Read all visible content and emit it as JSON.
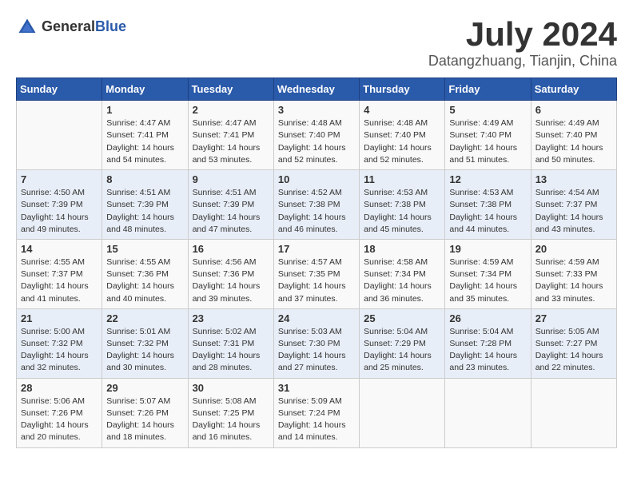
{
  "logo": {
    "general": "General",
    "blue": "Blue"
  },
  "title": "July 2024",
  "location": "Datangzhuang, Tianjin, China",
  "weekdays": [
    "Sunday",
    "Monday",
    "Tuesday",
    "Wednesday",
    "Thursday",
    "Friday",
    "Saturday"
  ],
  "weeks": [
    [
      {
        "day": "",
        "sunrise": "",
        "sunset": "",
        "daylight": ""
      },
      {
        "day": "1",
        "sunrise": "Sunrise: 4:47 AM",
        "sunset": "Sunset: 7:41 PM",
        "daylight": "Daylight: 14 hours and 54 minutes."
      },
      {
        "day": "2",
        "sunrise": "Sunrise: 4:47 AM",
        "sunset": "Sunset: 7:41 PM",
        "daylight": "Daylight: 14 hours and 53 minutes."
      },
      {
        "day": "3",
        "sunrise": "Sunrise: 4:48 AM",
        "sunset": "Sunset: 7:40 PM",
        "daylight": "Daylight: 14 hours and 52 minutes."
      },
      {
        "day": "4",
        "sunrise": "Sunrise: 4:48 AM",
        "sunset": "Sunset: 7:40 PM",
        "daylight": "Daylight: 14 hours and 52 minutes."
      },
      {
        "day": "5",
        "sunrise": "Sunrise: 4:49 AM",
        "sunset": "Sunset: 7:40 PM",
        "daylight": "Daylight: 14 hours and 51 minutes."
      },
      {
        "day": "6",
        "sunrise": "Sunrise: 4:49 AM",
        "sunset": "Sunset: 7:40 PM",
        "daylight": "Daylight: 14 hours and 50 minutes."
      }
    ],
    [
      {
        "day": "7",
        "sunrise": "Sunrise: 4:50 AM",
        "sunset": "Sunset: 7:39 PM",
        "daylight": "Daylight: 14 hours and 49 minutes."
      },
      {
        "day": "8",
        "sunrise": "Sunrise: 4:51 AM",
        "sunset": "Sunset: 7:39 PM",
        "daylight": "Daylight: 14 hours and 48 minutes."
      },
      {
        "day": "9",
        "sunrise": "Sunrise: 4:51 AM",
        "sunset": "Sunset: 7:39 PM",
        "daylight": "Daylight: 14 hours and 47 minutes."
      },
      {
        "day": "10",
        "sunrise": "Sunrise: 4:52 AM",
        "sunset": "Sunset: 7:38 PM",
        "daylight": "Daylight: 14 hours and 46 minutes."
      },
      {
        "day": "11",
        "sunrise": "Sunrise: 4:53 AM",
        "sunset": "Sunset: 7:38 PM",
        "daylight": "Daylight: 14 hours and 45 minutes."
      },
      {
        "day": "12",
        "sunrise": "Sunrise: 4:53 AM",
        "sunset": "Sunset: 7:38 PM",
        "daylight": "Daylight: 14 hours and 44 minutes."
      },
      {
        "day": "13",
        "sunrise": "Sunrise: 4:54 AM",
        "sunset": "Sunset: 7:37 PM",
        "daylight": "Daylight: 14 hours and 43 minutes."
      }
    ],
    [
      {
        "day": "14",
        "sunrise": "Sunrise: 4:55 AM",
        "sunset": "Sunset: 7:37 PM",
        "daylight": "Daylight: 14 hours and 41 minutes."
      },
      {
        "day": "15",
        "sunrise": "Sunrise: 4:55 AM",
        "sunset": "Sunset: 7:36 PM",
        "daylight": "Daylight: 14 hours and 40 minutes."
      },
      {
        "day": "16",
        "sunrise": "Sunrise: 4:56 AM",
        "sunset": "Sunset: 7:36 PM",
        "daylight": "Daylight: 14 hours and 39 minutes."
      },
      {
        "day": "17",
        "sunrise": "Sunrise: 4:57 AM",
        "sunset": "Sunset: 7:35 PM",
        "daylight": "Daylight: 14 hours and 37 minutes."
      },
      {
        "day": "18",
        "sunrise": "Sunrise: 4:58 AM",
        "sunset": "Sunset: 7:34 PM",
        "daylight": "Daylight: 14 hours and 36 minutes."
      },
      {
        "day": "19",
        "sunrise": "Sunrise: 4:59 AM",
        "sunset": "Sunset: 7:34 PM",
        "daylight": "Daylight: 14 hours and 35 minutes."
      },
      {
        "day": "20",
        "sunrise": "Sunrise: 4:59 AM",
        "sunset": "Sunset: 7:33 PM",
        "daylight": "Daylight: 14 hours and 33 minutes."
      }
    ],
    [
      {
        "day": "21",
        "sunrise": "Sunrise: 5:00 AM",
        "sunset": "Sunset: 7:32 PM",
        "daylight": "Daylight: 14 hours and 32 minutes."
      },
      {
        "day": "22",
        "sunrise": "Sunrise: 5:01 AM",
        "sunset": "Sunset: 7:32 PM",
        "daylight": "Daylight: 14 hours and 30 minutes."
      },
      {
        "day": "23",
        "sunrise": "Sunrise: 5:02 AM",
        "sunset": "Sunset: 7:31 PM",
        "daylight": "Daylight: 14 hours and 28 minutes."
      },
      {
        "day": "24",
        "sunrise": "Sunrise: 5:03 AM",
        "sunset": "Sunset: 7:30 PM",
        "daylight": "Daylight: 14 hours and 27 minutes."
      },
      {
        "day": "25",
        "sunrise": "Sunrise: 5:04 AM",
        "sunset": "Sunset: 7:29 PM",
        "daylight": "Daylight: 14 hours and 25 minutes."
      },
      {
        "day": "26",
        "sunrise": "Sunrise: 5:04 AM",
        "sunset": "Sunset: 7:28 PM",
        "daylight": "Daylight: 14 hours and 23 minutes."
      },
      {
        "day": "27",
        "sunrise": "Sunrise: 5:05 AM",
        "sunset": "Sunset: 7:27 PM",
        "daylight": "Daylight: 14 hours and 22 minutes."
      }
    ],
    [
      {
        "day": "28",
        "sunrise": "Sunrise: 5:06 AM",
        "sunset": "Sunset: 7:26 PM",
        "daylight": "Daylight: 14 hours and 20 minutes."
      },
      {
        "day": "29",
        "sunrise": "Sunrise: 5:07 AM",
        "sunset": "Sunset: 7:26 PM",
        "daylight": "Daylight: 14 hours and 18 minutes."
      },
      {
        "day": "30",
        "sunrise": "Sunrise: 5:08 AM",
        "sunset": "Sunset: 7:25 PM",
        "daylight": "Daylight: 14 hours and 16 minutes."
      },
      {
        "day": "31",
        "sunrise": "Sunrise: 5:09 AM",
        "sunset": "Sunset: 7:24 PM",
        "daylight": "Daylight: 14 hours and 14 minutes."
      },
      {
        "day": "",
        "sunrise": "",
        "sunset": "",
        "daylight": ""
      },
      {
        "day": "",
        "sunrise": "",
        "sunset": "",
        "daylight": ""
      },
      {
        "day": "",
        "sunrise": "",
        "sunset": "",
        "daylight": ""
      }
    ]
  ]
}
